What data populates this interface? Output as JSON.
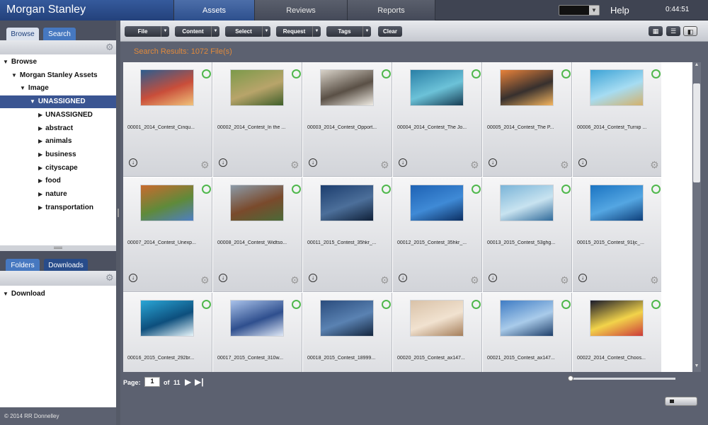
{
  "brand": "Morgan Stanley",
  "tabs": [
    {
      "label": "Assets",
      "active": true
    },
    {
      "label": "Reviews",
      "active": false
    },
    {
      "label": "Reports",
      "active": false
    }
  ],
  "help": "Help",
  "clock": "0:44:51",
  "left_top_tabs": {
    "browse": "Browse",
    "search": "Search"
  },
  "tree": [
    {
      "label": "Browse",
      "indent": 0,
      "expanded": true
    },
    {
      "label": "Morgan Stanley Assets",
      "indent": 1,
      "expanded": true
    },
    {
      "label": "Image",
      "indent": 2,
      "expanded": true
    },
    {
      "label": "UNASSIGNED",
      "indent": 3,
      "expanded": true,
      "selected": true
    },
    {
      "label": "UNASSIGNED",
      "indent": 4,
      "expanded": false
    },
    {
      "label": "abstract",
      "indent": 4,
      "expanded": false
    },
    {
      "label": "animals",
      "indent": 4,
      "expanded": false
    },
    {
      "label": "business",
      "indent": 4,
      "expanded": false
    },
    {
      "label": "cityscape",
      "indent": 4,
      "expanded": false
    },
    {
      "label": "food",
      "indent": 4,
      "expanded": false
    },
    {
      "label": "nature",
      "indent": 4,
      "expanded": false
    },
    {
      "label": "transportation",
      "indent": 4,
      "expanded": false
    }
  ],
  "left_bottom_tabs": {
    "folders": "Folders",
    "downloads": "Downloads"
  },
  "download_tree": {
    "label": "Download"
  },
  "copyright": "© 2014 RR Donnelley",
  "toolbar": {
    "file": "File",
    "content": "Content",
    "select": "Select",
    "request": "Request",
    "tags": "Tags",
    "clear": "Clear"
  },
  "results_text": "Search Results: 1072 File(s)",
  "assets": [
    {
      "caption": "00001_2014_Contest_Cinqu...",
      "colors": [
        "#2c5d8f",
        "#c94e3a",
        "#f0c27a"
      ]
    },
    {
      "caption": "00002_2014_Contest_In the ...",
      "colors": [
        "#7c9a4a",
        "#b8a46a",
        "#3f5f2a"
      ]
    },
    {
      "caption": "00003_2014_Contest_Opport...",
      "colors": [
        "#d8d2c8",
        "#5a5046",
        "#f0ece4"
      ]
    },
    {
      "caption": "00004_2014_Contest_The Jo...",
      "colors": [
        "#2a7fa6",
        "#6cc2d8",
        "#173d54"
      ]
    },
    {
      "caption": "00005_2014_Contest_The P...",
      "colors": [
        "#e8823a",
        "#37302e",
        "#f5b55f"
      ]
    },
    {
      "caption": "00006_2014_Contest_Turnip ...",
      "colors": [
        "#3da3d6",
        "#a6dcf2",
        "#d4b16a"
      ]
    },
    {
      "caption": "00007_2014_Contest_Unexp...",
      "colors": [
        "#c96a2e",
        "#5f8a3a",
        "#4e7fc4"
      ]
    },
    {
      "caption": "00008_2014_Contest_Widtso...",
      "colors": [
        "#8b9aa8",
        "#7a4a2c",
        "#4b6a38"
      ]
    },
    {
      "caption": "00011_2015_Contest_35hkr_...",
      "colors": [
        "#1c3d6e",
        "#4c6f9a",
        "#0f2038"
      ]
    },
    {
      "caption": "00012_2015_Contest_35hkr_...",
      "colors": [
        "#1e62b4",
        "#3f8ad6",
        "#0c2f62"
      ]
    },
    {
      "caption": "00013_2015_Contest_53ghg...",
      "colors": [
        "#7ab4d8",
        "#c8e3f0",
        "#2f6a9a"
      ]
    },
    {
      "caption": "00015_2015_Contest_91ljc_...",
      "colors": [
        "#1b74c2",
        "#54a6e2",
        "#0e3f7a"
      ]
    },
    {
      "caption": "00016_2015_Contest_292br...",
      "colors": [
        "#2aa6d6",
        "#0d4f7d",
        "#e8f6fb"
      ]
    },
    {
      "caption": "00017_2015_Contest_310w...",
      "colors": [
        "#a9c2ea",
        "#2f4f8e",
        "#dfe8f7"
      ]
    },
    {
      "caption": "00018_2015_Contest_18999...",
      "colors": [
        "#2a4c7d",
        "#5a82b2",
        "#14263e"
      ]
    },
    {
      "caption": "00020_2015_Contest_ax147...",
      "colors": [
        "#d9c2a8",
        "#f1e2d0",
        "#a57e5a"
      ]
    },
    {
      "caption": "00021_2015_Contest_ax147...",
      "colors": [
        "#3f7cc4",
        "#a9cbea",
        "#1f3f6a"
      ]
    },
    {
      "caption": "00022_2014_Contest_Choos...",
      "colors": [
        "#1a1a2a",
        "#f2d34a",
        "#cc3a3a"
      ]
    }
  ],
  "pager": {
    "label": "Page:",
    "current": "1",
    "of": "of",
    "total": "11"
  }
}
